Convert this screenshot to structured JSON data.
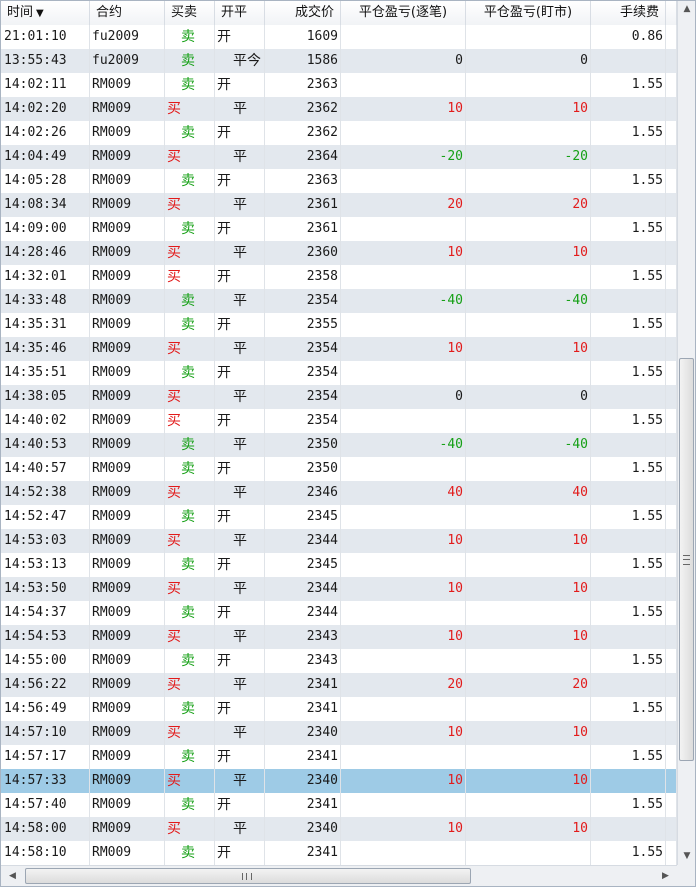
{
  "columns": {
    "time": "时间",
    "contract": "合约",
    "direction": "买卖",
    "open_close": "开平",
    "price": "成交价",
    "pnl_per_trade": "平仓盈亏(逐笔)",
    "pnl_mark": "平仓盈亏(盯市)",
    "fee": "手续费"
  },
  "sort_indicator": "▼",
  "rows": [
    {
      "time": "21:01:10",
      "contract": "fu2009",
      "direction": "卖",
      "open_close": "开",
      "price": "1609",
      "pnl1": "",
      "pnl2": "",
      "fee": "0.86"
    },
    {
      "time": "13:55:43",
      "contract": "fu2009",
      "direction": "卖",
      "open_close": "平今",
      "price": "1586",
      "pnl1": "0",
      "pnl2": "0",
      "fee": ""
    },
    {
      "time": "14:02:11",
      "contract": "RM009",
      "direction": "卖",
      "open_close": "开",
      "price": "2363",
      "pnl1": "",
      "pnl2": "",
      "fee": "1.55"
    },
    {
      "time": "14:02:20",
      "contract": "RM009",
      "direction": "买",
      "open_close": "平",
      "price": "2362",
      "pnl1": "10",
      "pnl2": "10",
      "fee": ""
    },
    {
      "time": "14:02:26",
      "contract": "RM009",
      "direction": "卖",
      "open_close": "开",
      "price": "2362",
      "pnl1": "",
      "pnl2": "",
      "fee": "1.55"
    },
    {
      "time": "14:04:49",
      "contract": "RM009",
      "direction": "买",
      "open_close": "平",
      "price": "2364",
      "pnl1": "-20",
      "pnl2": "-20",
      "fee": ""
    },
    {
      "time": "14:05:28",
      "contract": "RM009",
      "direction": "卖",
      "open_close": "开",
      "price": "2363",
      "pnl1": "",
      "pnl2": "",
      "fee": "1.55"
    },
    {
      "time": "14:08:34",
      "contract": "RM009",
      "direction": "买",
      "open_close": "平",
      "price": "2361",
      "pnl1": "20",
      "pnl2": "20",
      "fee": ""
    },
    {
      "time": "14:09:00",
      "contract": "RM009",
      "direction": "卖",
      "open_close": "开",
      "price": "2361",
      "pnl1": "",
      "pnl2": "",
      "fee": "1.55"
    },
    {
      "time": "14:28:46",
      "contract": "RM009",
      "direction": "买",
      "open_close": "平",
      "price": "2360",
      "pnl1": "10",
      "pnl2": "10",
      "fee": ""
    },
    {
      "time": "14:32:01",
      "contract": "RM009",
      "direction": "买",
      "open_close": "开",
      "price": "2358",
      "pnl1": "",
      "pnl2": "",
      "fee": "1.55"
    },
    {
      "time": "14:33:48",
      "contract": "RM009",
      "direction": "卖",
      "open_close": "平",
      "price": "2354",
      "pnl1": "-40",
      "pnl2": "-40",
      "fee": ""
    },
    {
      "time": "14:35:31",
      "contract": "RM009",
      "direction": "卖",
      "open_close": "开",
      "price": "2355",
      "pnl1": "",
      "pnl2": "",
      "fee": "1.55"
    },
    {
      "time": "14:35:46",
      "contract": "RM009",
      "direction": "买",
      "open_close": "平",
      "price": "2354",
      "pnl1": "10",
      "pnl2": "10",
      "fee": ""
    },
    {
      "time": "14:35:51",
      "contract": "RM009",
      "direction": "卖",
      "open_close": "开",
      "price": "2354",
      "pnl1": "",
      "pnl2": "",
      "fee": "1.55"
    },
    {
      "time": "14:38:05",
      "contract": "RM009",
      "direction": "买",
      "open_close": "平",
      "price": "2354",
      "pnl1": "0",
      "pnl2": "0",
      "fee": ""
    },
    {
      "time": "14:40:02",
      "contract": "RM009",
      "direction": "买",
      "open_close": "开",
      "price": "2354",
      "pnl1": "",
      "pnl2": "",
      "fee": "1.55"
    },
    {
      "time": "14:40:53",
      "contract": "RM009",
      "direction": "卖",
      "open_close": "平",
      "price": "2350",
      "pnl1": "-40",
      "pnl2": "-40",
      "fee": ""
    },
    {
      "time": "14:40:57",
      "contract": "RM009",
      "direction": "卖",
      "open_close": "开",
      "price": "2350",
      "pnl1": "",
      "pnl2": "",
      "fee": "1.55"
    },
    {
      "time": "14:52:38",
      "contract": "RM009",
      "direction": "买",
      "open_close": "平",
      "price": "2346",
      "pnl1": "40",
      "pnl2": "40",
      "fee": ""
    },
    {
      "time": "14:52:47",
      "contract": "RM009",
      "direction": "卖",
      "open_close": "开",
      "price": "2345",
      "pnl1": "",
      "pnl2": "",
      "fee": "1.55"
    },
    {
      "time": "14:53:03",
      "contract": "RM009",
      "direction": "买",
      "open_close": "平",
      "price": "2344",
      "pnl1": "10",
      "pnl2": "10",
      "fee": ""
    },
    {
      "time": "14:53:13",
      "contract": "RM009",
      "direction": "卖",
      "open_close": "开",
      "price": "2345",
      "pnl1": "",
      "pnl2": "",
      "fee": "1.55"
    },
    {
      "time": "14:53:50",
      "contract": "RM009",
      "direction": "买",
      "open_close": "平",
      "price": "2344",
      "pnl1": "10",
      "pnl2": "10",
      "fee": ""
    },
    {
      "time": "14:54:37",
      "contract": "RM009",
      "direction": "卖",
      "open_close": "开",
      "price": "2344",
      "pnl1": "",
      "pnl2": "",
      "fee": "1.55"
    },
    {
      "time": "14:54:53",
      "contract": "RM009",
      "direction": "买",
      "open_close": "平",
      "price": "2343",
      "pnl1": "10",
      "pnl2": "10",
      "fee": ""
    },
    {
      "time": "14:55:00",
      "contract": "RM009",
      "direction": "卖",
      "open_close": "开",
      "price": "2343",
      "pnl1": "",
      "pnl2": "",
      "fee": "1.55"
    },
    {
      "time": "14:56:22",
      "contract": "RM009",
      "direction": "买",
      "open_close": "平",
      "price": "2341",
      "pnl1": "20",
      "pnl2": "20",
      "fee": ""
    },
    {
      "time": "14:56:49",
      "contract": "RM009",
      "direction": "卖",
      "open_close": "开",
      "price": "2341",
      "pnl1": "",
      "pnl2": "",
      "fee": "1.55"
    },
    {
      "time": "14:57:10",
      "contract": "RM009",
      "direction": "买",
      "open_close": "平",
      "price": "2340",
      "pnl1": "10",
      "pnl2": "10",
      "fee": ""
    },
    {
      "time": "14:57:17",
      "contract": "RM009",
      "direction": "卖",
      "open_close": "开",
      "price": "2341",
      "pnl1": "",
      "pnl2": "",
      "fee": "1.55"
    },
    {
      "time": "14:57:33",
      "contract": "RM009",
      "direction": "买",
      "open_close": "平",
      "price": "2340",
      "pnl1": "10",
      "pnl2": "10",
      "fee": "",
      "selected": true
    },
    {
      "time": "14:57:40",
      "contract": "RM009",
      "direction": "卖",
      "open_close": "开",
      "price": "2341",
      "pnl1": "",
      "pnl2": "",
      "fee": "1.55"
    },
    {
      "time": "14:58:00",
      "contract": "RM009",
      "direction": "买",
      "open_close": "平",
      "price": "2340",
      "pnl1": "10",
      "pnl2": "10",
      "fee": ""
    },
    {
      "time": "14:58:10",
      "contract": "RM009",
      "direction": "卖",
      "open_close": "开",
      "price": "2341",
      "pnl1": "",
      "pnl2": "",
      "fee": "1.55"
    }
  ],
  "colors": {
    "buy": "#e21b1b",
    "sell": "#16a016",
    "selected_row": "#9ecbe6",
    "alt_row": "#e3e8ee"
  },
  "icons": {
    "sort": "sort-desc-icon",
    "scroll_up": "arrow-up-icon",
    "scroll_down": "arrow-down-icon",
    "scroll_left": "arrow-left-icon",
    "scroll_right": "arrow-right-icon"
  }
}
